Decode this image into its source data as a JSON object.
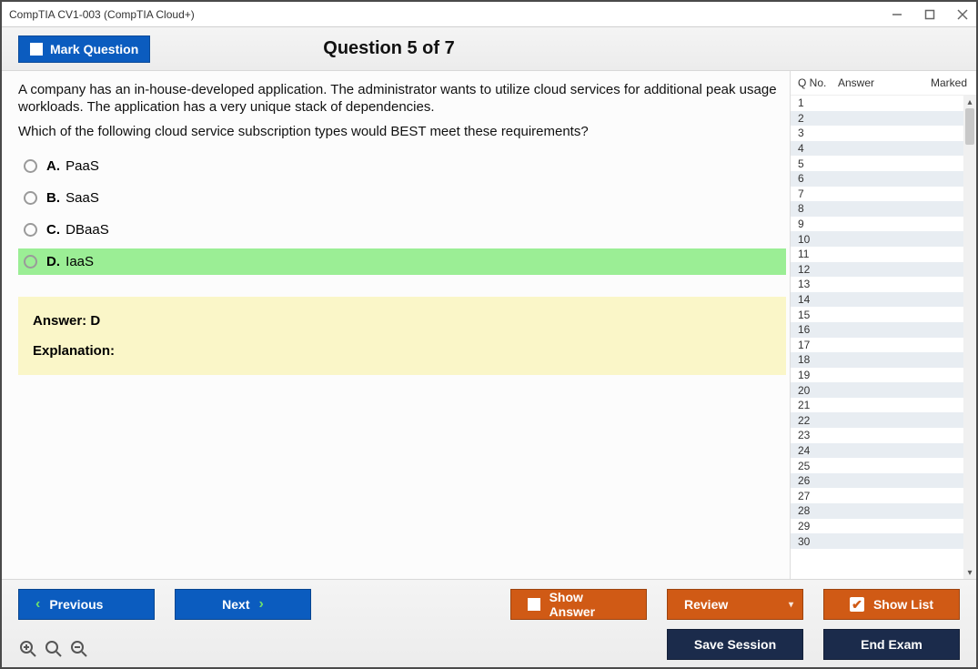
{
  "window": {
    "title": "CompTIA CV1-003 (CompTIA Cloud+)"
  },
  "header": {
    "mark_label": "Mark Question",
    "question_title": "Question 5 of 7"
  },
  "question": {
    "para1": "A company has an in-house-developed application. The administrator wants to utilize cloud services for additional peak usage workloads. The application has a very unique stack of dependencies.",
    "para2": "Which of the following cloud service subscription types would BEST meet these requirements?",
    "choices": [
      {
        "letter": "A.",
        "text": "PaaS",
        "correct": false
      },
      {
        "letter": "B.",
        "text": "SaaS",
        "correct": false
      },
      {
        "letter": "C.",
        "text": "DBaaS",
        "correct": false
      },
      {
        "letter": "D.",
        "text": "IaaS",
        "correct": true
      }
    ],
    "answer_label": "Answer: D",
    "explanation_label": "Explanation:"
  },
  "sidebar": {
    "headers": {
      "qno": "Q No.",
      "answer": "Answer",
      "marked": "Marked"
    },
    "rows": [
      1,
      2,
      3,
      4,
      5,
      6,
      7,
      8,
      9,
      10,
      11,
      12,
      13,
      14,
      15,
      16,
      17,
      18,
      19,
      20,
      21,
      22,
      23,
      24,
      25,
      26,
      27,
      28,
      29,
      30
    ]
  },
  "footer": {
    "previous": "Previous",
    "next": "Next",
    "show_answer": "Show Answer",
    "review": "Review",
    "show_list": "Show List",
    "save_session": "Save Session",
    "end_exam": "End Exam"
  },
  "zoom": {
    "reset": "zoom-reset",
    "in": "zoom-in",
    "out": "zoom-out"
  }
}
